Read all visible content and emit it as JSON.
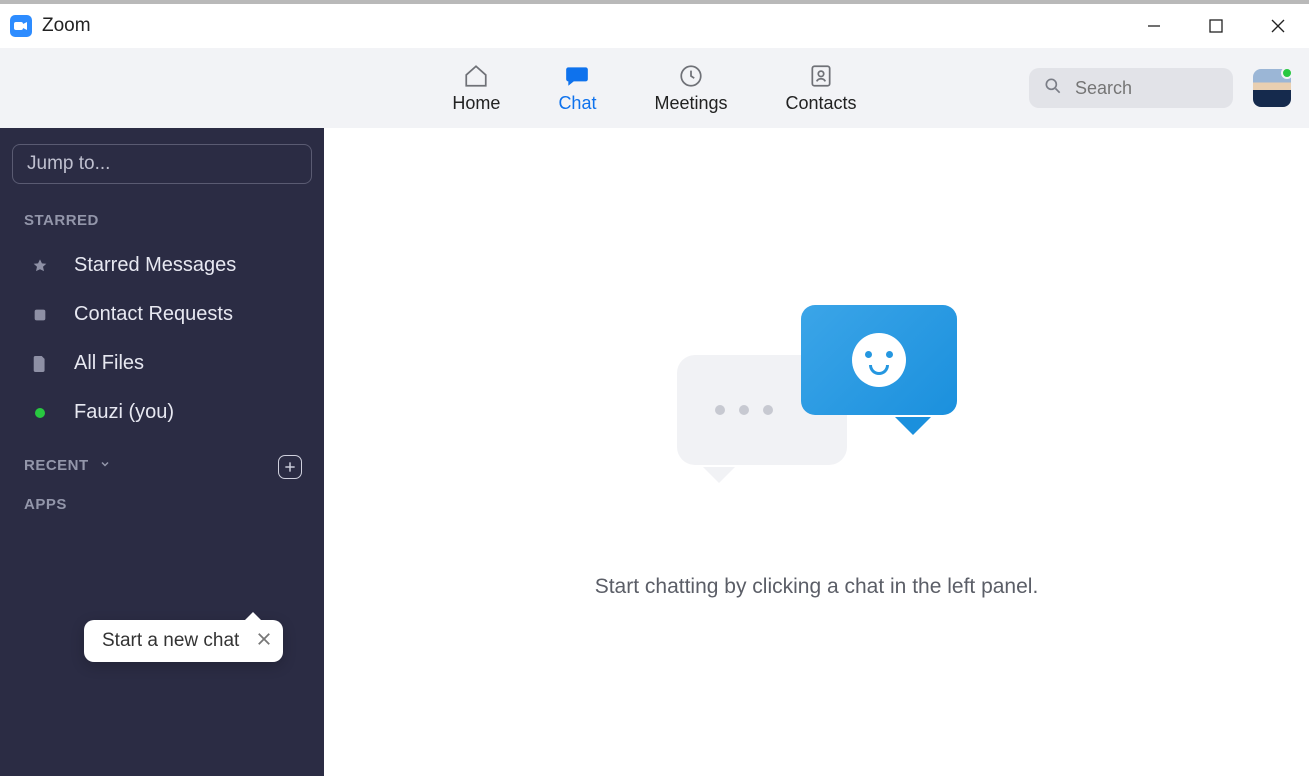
{
  "window": {
    "title": "Zoom"
  },
  "topnav": {
    "items": [
      {
        "label": "Home"
      },
      {
        "label": "Chat"
      },
      {
        "label": "Meetings"
      },
      {
        "label": "Contacts"
      }
    ],
    "search_placeholder": "Search"
  },
  "sidebar": {
    "jump_placeholder": "Jump to...",
    "sections": {
      "starred_label": "STARRED",
      "recent_label": "RECENT",
      "apps_label": "APPS"
    },
    "starred_items": [
      {
        "label": "Starred Messages"
      },
      {
        "label": "Contact Requests"
      },
      {
        "label": "All Files"
      },
      {
        "label": "Fauzi (you)"
      }
    ],
    "tooltip": "Start a new chat"
  },
  "main": {
    "empty_text": "Start chatting by clicking a chat in the left panel."
  }
}
